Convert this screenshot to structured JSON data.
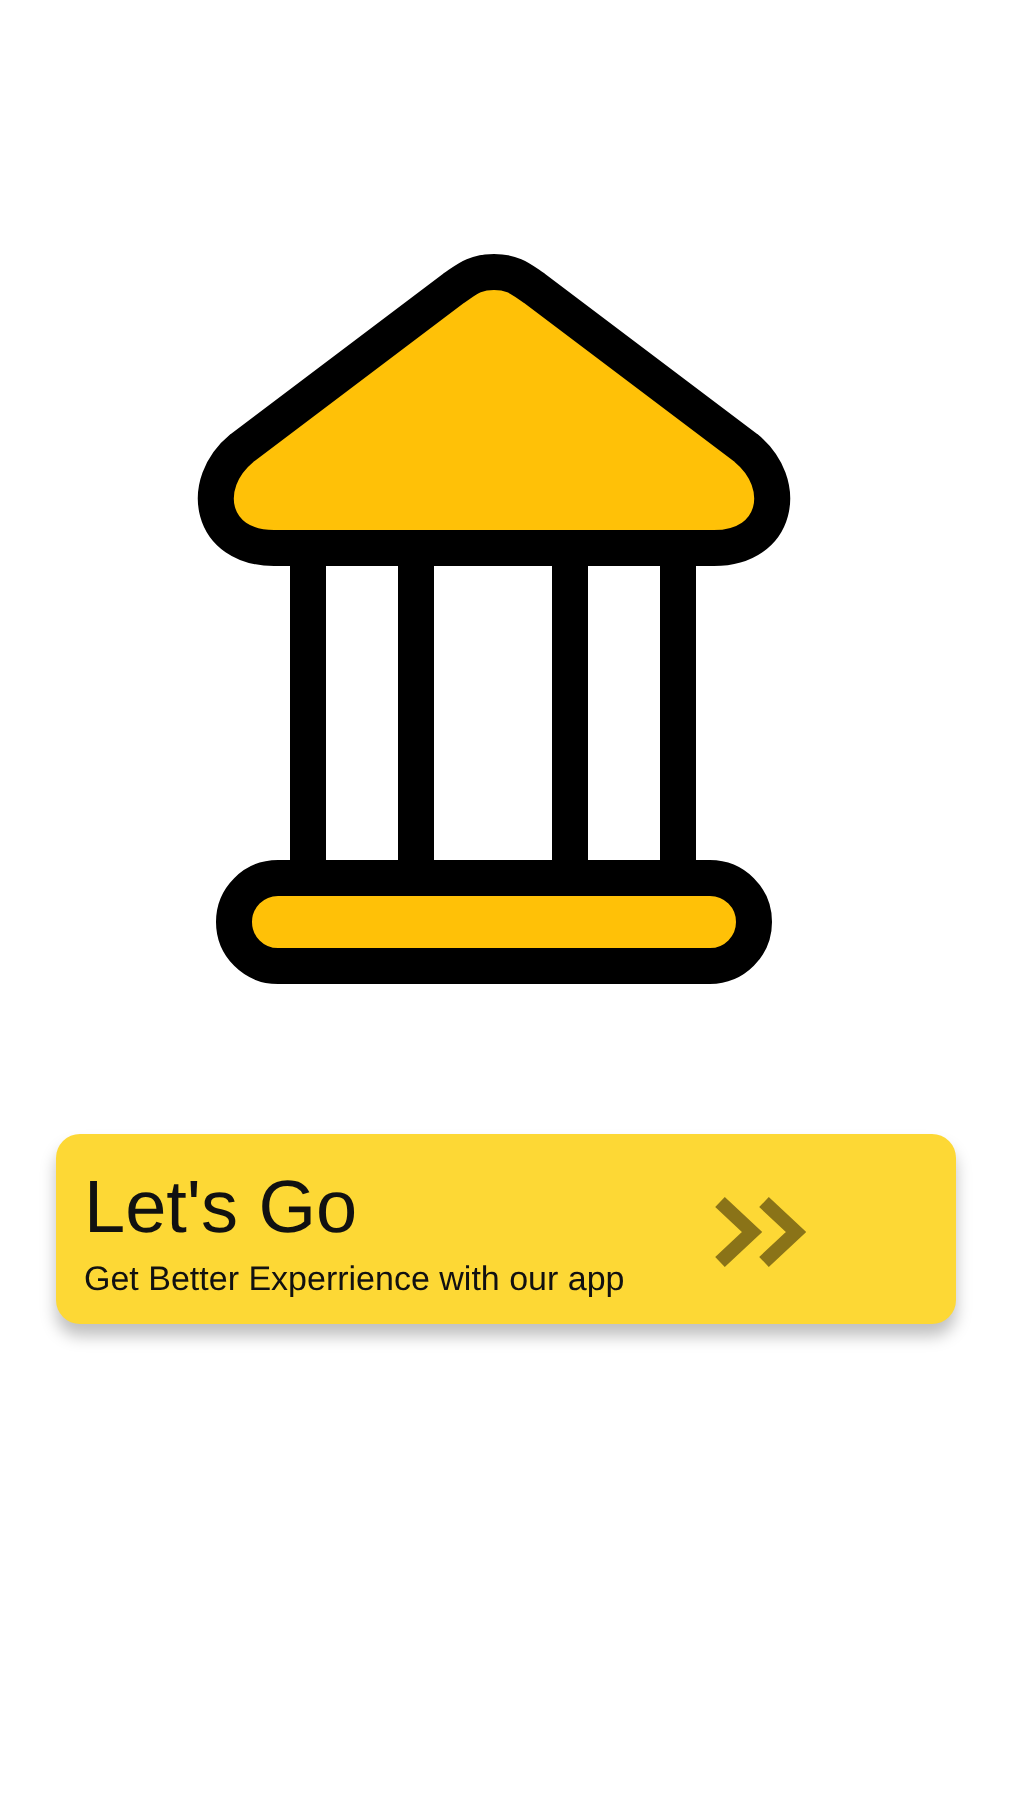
{
  "card": {
    "title": "Let's Go",
    "subtitle": "Get Better Experrience with our app"
  }
}
